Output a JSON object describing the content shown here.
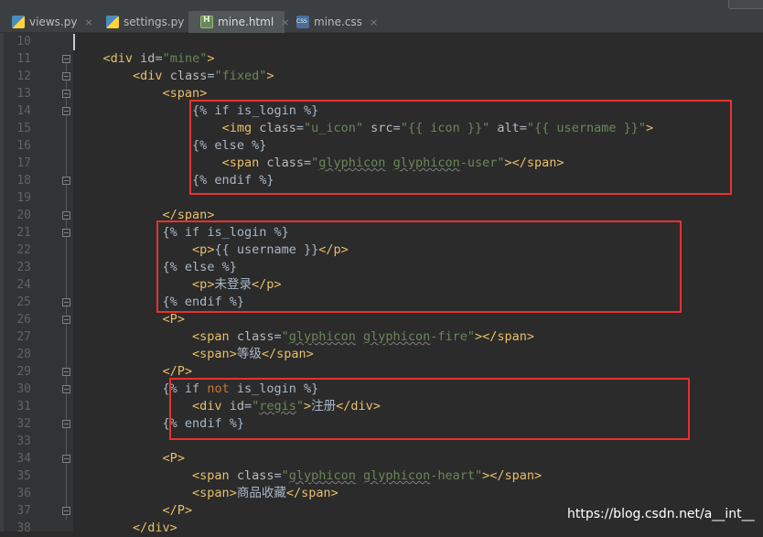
{
  "tabs": [
    {
      "label": "views.py",
      "icon": "python-file-icon",
      "close": "×"
    },
    {
      "label": "settings.py",
      "icon": "python-file-icon",
      "close": "×"
    },
    {
      "label": "mine.html",
      "icon": "html-file-icon",
      "close": "×",
      "active": true
    },
    {
      "label": "mine.css",
      "icon": "css-file-icon",
      "close": "×"
    }
  ],
  "line_numbers": [
    "10",
    "11",
    "12",
    "13",
    "14",
    "15",
    "16",
    "17",
    "18",
    "19",
    "20",
    "21",
    "22",
    "23",
    "24",
    "25",
    "26",
    "27",
    "28",
    "29",
    "30",
    "31",
    "32",
    "33",
    "34",
    "35",
    "36",
    "37",
    "38"
  ],
  "code_lines": [
    "",
    "    <div id=\"mine\">",
    "        <div class=\"fixed\">",
    "            <span>",
    "                {% if is_login %}",
    "                    <img class=\"u_icon\" src=\"{{ icon }}\" alt=\"{{ username }}\">",
    "                {% else %}",
    "                    <span class=\"glyphicon glyphicon-user\"></span>",
    "                {% endif %}",
    "",
    "            </span>",
    "            {% if is_login %}",
    "                <p>{{ username }}</p>",
    "            {% else %}",
    "                <p>未登录</p>",
    "            {% endif %}",
    "            <P>",
    "                <span class=\"glyphicon glyphicon-fire\"></span>",
    "                <span>等级</span>",
    "            </P>",
    "            {% if not is_login %}",
    "                <div id=\"regis\">注册</div>",
    "            {% endif %}",
    "",
    "            <P>",
    "                <span class=\"glyphicon glyphicon-heart\"></span>",
    "                <span>商品收藏</span>",
    "            </P>",
    "        </div>"
  ],
  "watermark": "https://blog.csdn.net/a__int__",
  "colors": {
    "background": "#2b2b2b",
    "gutter": "#313335",
    "tag": "#e8bf6a",
    "attribute": "#bababa",
    "string": "#6a8759",
    "keyword": "#cc7832",
    "text": "#a9b7c6",
    "line_number": "#606366",
    "highlight_box": "#e8312f"
  }
}
